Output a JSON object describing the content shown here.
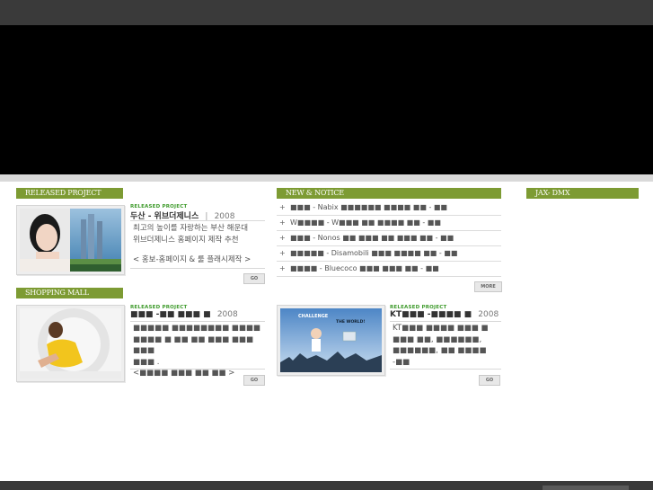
{
  "sections": {
    "released_project": "RELEASED PROJECT",
    "shopping_mall": "SHOPPING MALL",
    "new_notice": "NEW & NOTICE",
    "jax_dmx": "JAX- DMX"
  },
  "projects": [
    {
      "kicker": "RELEASED PROJECT",
      "title": "두산 - 위브더제니스",
      "sep": "|",
      "year": "2008",
      "desc_line1": "최고의 높이를 자랑하는 부산 해운대",
      "desc_line2": "위브더제니스 홈페이지 제작 추천",
      "link": "< 홍보-홈페이지 & 룰 플래시제작 >",
      "go": "GO"
    },
    {
      "kicker": "RELEASED PROJECT",
      "title": "■■■ -■■ ■■■ ■",
      "year": "2008",
      "desc_line1": "■■■■■ ■■■■■■■■ ■■■■",
      "desc_line2": "■■■■ ■ ■■ ■■ ■■■ ■■■ ■■■",
      "desc_line3": "■■■ .",
      "link": "<■■■■ ■■■ ■■ ■■ >",
      "go": "GO"
    },
    {
      "kicker": "RELEASED PROJECT",
      "title": "KT■■■ -■■■■ ■",
      "year": "2008",
      "desc_line1": "KT■■■ ■■■■ ■■■ ■",
      "desc_line2": "■■■ ■■, ■■■■■■,",
      "desc_line3": "■■■■■■, ■■ ■■■■",
      "desc_line4": "-■■",
      "go": "GO"
    }
  ],
  "thumb_banner": {
    "line1": "CHALLENGE",
    "line2": "THE WORLD!"
  },
  "news": [
    {
      "bullet": "+",
      "text": "■■■  - Nabix ■■■■■■ ■■■■ ■■  - ■■"
    },
    {
      "bullet": "+",
      "text": "W■■■■ - W■■■ ■■ ■■■■ ■■  - ■■"
    },
    {
      "bullet": "+",
      "text": "■■■  - Nonos ■■ ■■■ ■■ ■■■ ■■  - ■■"
    },
    {
      "bullet": "+",
      "text": "■■■■■  - Disamobili ■■■ ■■■■ ■■  - ■■"
    },
    {
      "bullet": "+",
      "text": "■■■■  - Bluecoco ■■■ ■■■ ■■  - ■■"
    }
  ],
  "more": "MORE"
}
